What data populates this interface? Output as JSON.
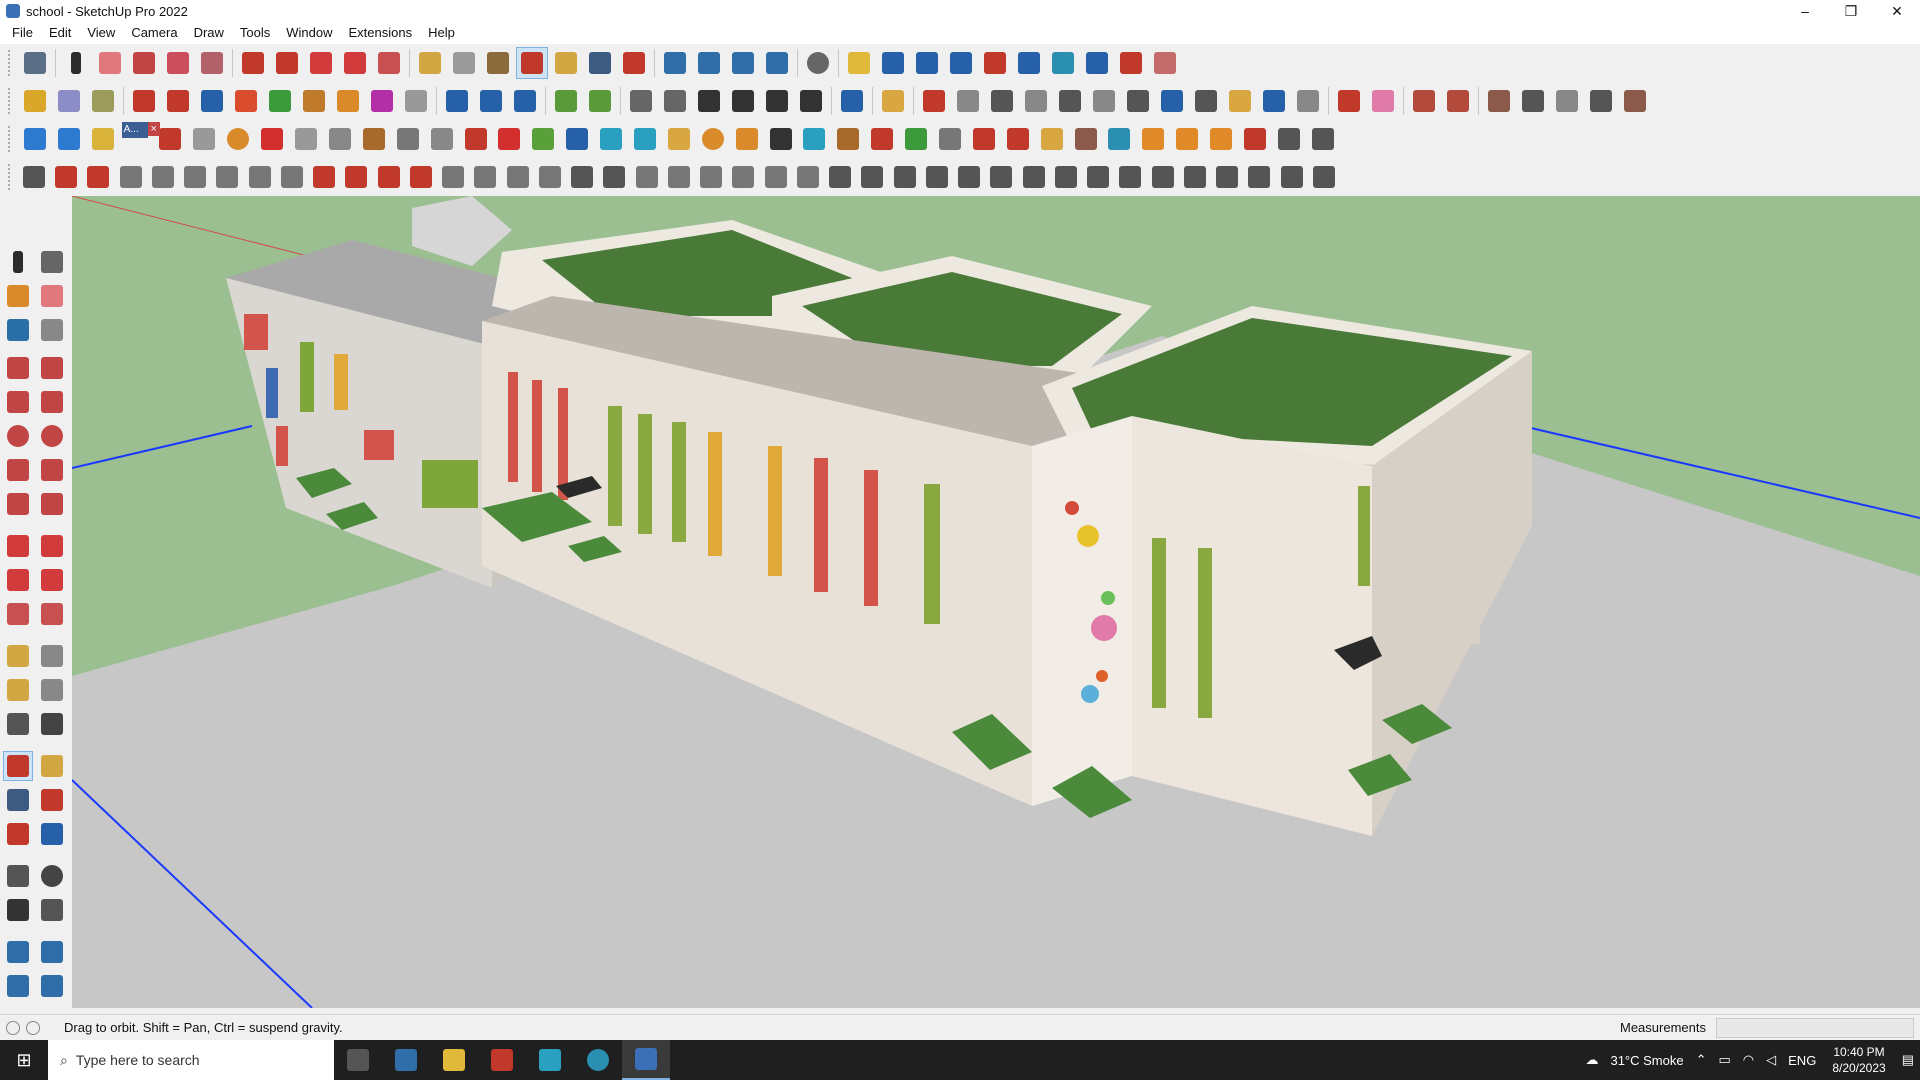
{
  "window": {
    "title": "school - SketchUp Pro 2022",
    "minimize": "–",
    "maximize": "❐",
    "close": "✕"
  },
  "menu": [
    "File",
    "Edit",
    "View",
    "Camera",
    "Draw",
    "Tools",
    "Window",
    "Extensions",
    "Help"
  ],
  "floating_panel": {
    "label": "A...",
    "close": "×"
  },
  "status": {
    "hint": "Drag to orbit. Shift = Pan, Ctrl = suspend gravity.",
    "measurements_label": "Measurements",
    "measurements_value": ""
  },
  "taskbar": {
    "search_placeholder": "Type here to search",
    "weather": "31°C Smoke",
    "language": "ENG",
    "time": "10:40 PM",
    "date": "8/20/2023"
  },
  "colors": {
    "sky": "#9bbf91",
    "ground": "#c7c7c7",
    "wall": "#e8e1d8",
    "roof_green": "#4a7a38",
    "accent": "#cfe3f7"
  }
}
